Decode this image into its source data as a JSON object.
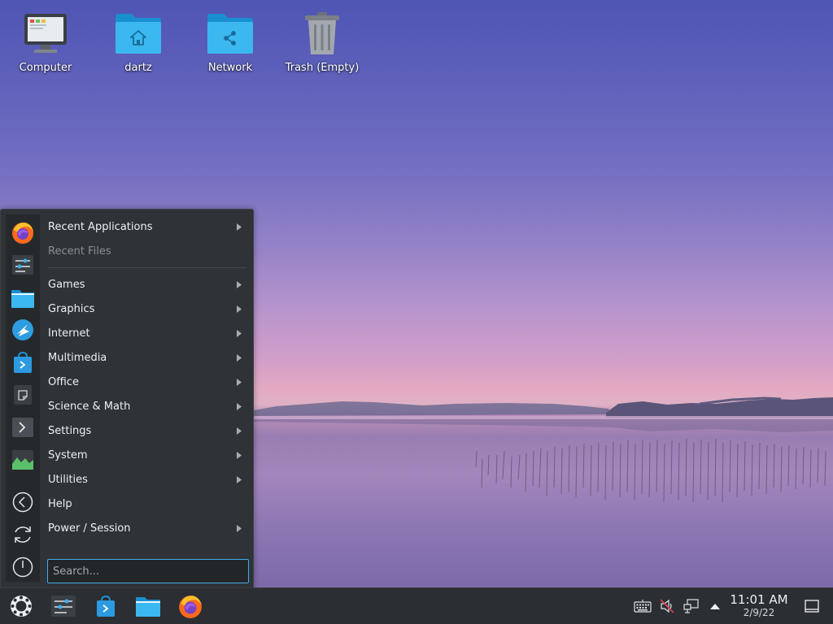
{
  "desktop": {
    "icons": [
      {
        "label": "Computer",
        "icon": "computer-icon"
      },
      {
        "label": "dartz",
        "icon": "home-folder-icon"
      },
      {
        "label": "Network",
        "icon": "network-folder-icon"
      },
      {
        "label": "Trash (Empty)",
        "icon": "trash-icon"
      }
    ]
  },
  "menu": {
    "favorites": [
      {
        "icon": "firefox-icon"
      },
      {
        "icon": "system-settings-icon"
      },
      {
        "icon": "file-manager-icon"
      },
      {
        "icon": "discover-globe-icon"
      },
      {
        "icon": "app-store-icon"
      },
      {
        "icon": "note-icon"
      },
      {
        "icon": "terminal-icon"
      },
      {
        "icon": "system-monitor-icon"
      }
    ],
    "session_actions": [
      {
        "icon": "back-icon"
      },
      {
        "icon": "restart-icon"
      },
      {
        "icon": "power-icon"
      }
    ],
    "items": [
      {
        "label": "Recent Applications"
      },
      {
        "label": "Recent Files"
      },
      {
        "label": "Games"
      },
      {
        "label": "Graphics"
      },
      {
        "label": "Internet"
      },
      {
        "label": "Multimedia"
      },
      {
        "label": "Office"
      },
      {
        "label": "Science & Math"
      },
      {
        "label": "Settings"
      },
      {
        "label": "System"
      },
      {
        "label": "Utilities"
      },
      {
        "label": "Help"
      },
      {
        "label": "Power / Session"
      }
    ],
    "search": {
      "placeholder": "Search..."
    }
  },
  "taskbar": {
    "launcher_icon": "application-launcher-icon",
    "tasks": [
      {
        "icon": "system-settings-icon"
      },
      {
        "icon": "app-store-icon"
      },
      {
        "icon": "file-manager-icon"
      },
      {
        "icon": "firefox-icon"
      }
    ],
    "tray": [
      {
        "icon": "keyboard-icon"
      },
      {
        "icon": "volume-muted-icon"
      },
      {
        "icon": "network-wired-icon"
      },
      {
        "icon": "tray-expand-arrow-icon"
      }
    ],
    "clock": {
      "time": "11:01 AM",
      "date": "2/9/22"
    },
    "show_desktop_icon": "show-desktop-icon"
  }
}
